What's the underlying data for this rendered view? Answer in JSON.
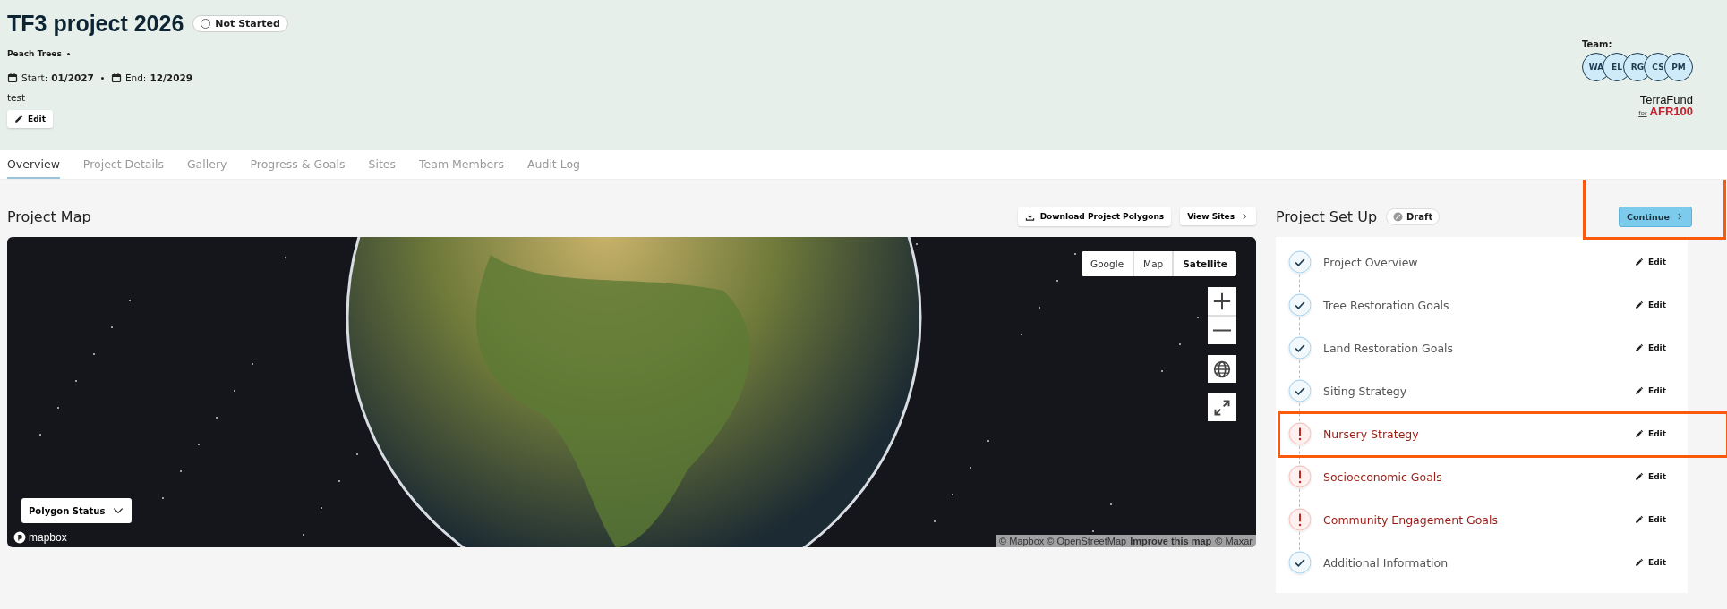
{
  "project": {
    "title": "TF3 project 2026",
    "status": "Not Started",
    "subtitle": "Peach Trees",
    "start_label": "Start:",
    "start": "01/2027",
    "end_label": "End:",
    "end": "12/2029",
    "description": "test",
    "edit": "Edit"
  },
  "team": {
    "label": "Team:",
    "members": [
      "WA",
      "EL",
      "RG",
      "CS",
      "PM"
    ]
  },
  "logo": {
    "line1": "TerraFund",
    "for": "for",
    "line2": "AFR100"
  },
  "tabs": [
    {
      "label": "Overview",
      "selected": true
    },
    {
      "label": "Project Details",
      "selected": false
    },
    {
      "label": "Gallery",
      "selected": false
    },
    {
      "label": "Progress & Goals",
      "selected": false
    },
    {
      "label": "Sites",
      "selected": false
    },
    {
      "label": "Team Members",
      "selected": false
    },
    {
      "label": "Audit Log",
      "selected": false
    }
  ],
  "map": {
    "title": "Project Map",
    "download": "Download Project Polygons",
    "view_sites": "View Sites",
    "layers": [
      {
        "label": "Google",
        "selected": false
      },
      {
        "label": "Map",
        "selected": false
      },
      {
        "label": "Satellite",
        "selected": true
      }
    ],
    "polygon_status": "Polygon Status",
    "brand": "mapbox",
    "attribution": "© Mapbox © OpenStreetMap",
    "improve": "Improve this map",
    "attribution_end": "© Maxar"
  },
  "setup": {
    "title": "Project Set Up",
    "status": "Draft",
    "continue": "Continue",
    "continue_highlighted": true,
    "steps": [
      {
        "label": "Project Overview",
        "kind": "complete",
        "highlighted": false,
        "edit": "Edit"
      },
      {
        "label": "Tree Restoration Goals",
        "kind": "complete",
        "highlighted": false,
        "edit": "Edit"
      },
      {
        "label": "Land Restoration Goals",
        "kind": "complete",
        "highlighted": false,
        "edit": "Edit"
      },
      {
        "label": "Siting Strategy",
        "kind": "complete",
        "highlighted": false,
        "edit": "Edit"
      },
      {
        "label": "Nursery Strategy",
        "kind": "incomplete",
        "highlighted": true,
        "edit": "Edit"
      },
      {
        "label": "Socioeconomic Goals",
        "kind": "incomplete",
        "highlighted": false,
        "edit": "Edit"
      },
      {
        "label": "Community Engagement Goals",
        "kind": "incomplete",
        "highlighted": false,
        "edit": "Edit"
      },
      {
        "label": "Additional Information",
        "kind": "complete",
        "highlighted": false,
        "edit": "Edit"
      }
    ]
  }
}
